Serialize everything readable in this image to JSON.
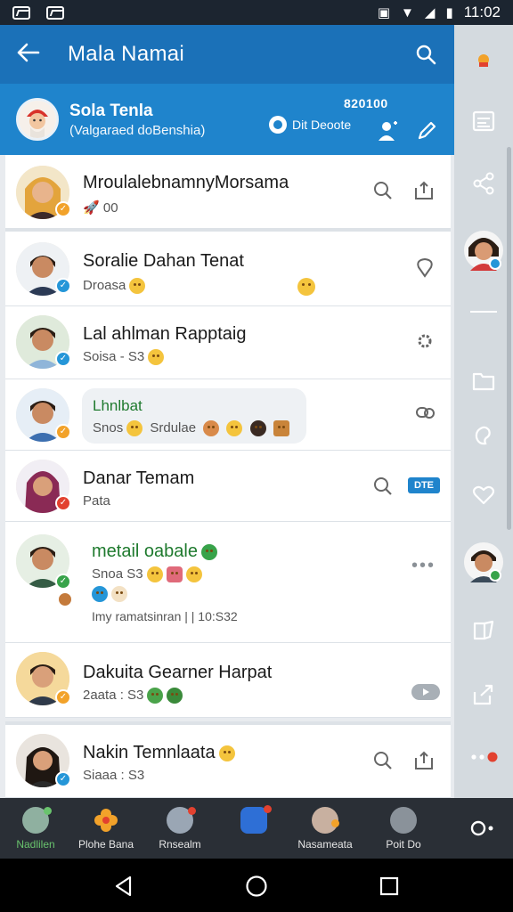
{
  "status_bar": {
    "time": "11:02"
  },
  "app_bar": {
    "title": "Mala Namai",
    "back_icon": "arrow-left-icon",
    "search_icon": "search-icon"
  },
  "profile": {
    "name": "Sola Tenla",
    "subtitle": "(Valgaraed doBenshia)",
    "count": "820100",
    "status_label": "Dit Deoote"
  },
  "chats": [
    {
      "name": "MroulalebnamnyMorsama",
      "sub": "00",
      "badge": "orange"
    },
    {
      "name": "Soralie Dahan Tenat",
      "sub": "Droasa",
      "badge": "blue"
    },
    {
      "name": "Lal ahlman Rapptaig",
      "sub": "Soisa - S3",
      "badge": "blue"
    },
    {
      "name": "Lhnlbat",
      "sub": "Snos",
      "sub2": "Srdulae",
      "badge": "orange"
    },
    {
      "name": "Danar Temam",
      "sub": "Pata",
      "badge": "red",
      "pill": "DTE"
    },
    {
      "name": "metail oabale",
      "sub": "Snoa S3",
      "meta": "Imy ramatsinran | | 10:S32",
      "badge": "green",
      "badge2": "brown"
    },
    {
      "name": "Dakuita Gearner Harpat",
      "sub": "2aata : S3",
      "badge": "orange"
    },
    {
      "name": "Nakin Temnlaata",
      "sub": "Siaaa : S3",
      "badge": "blue"
    }
  ],
  "tabs": [
    {
      "label": "Nadlilen",
      "active": true
    },
    {
      "label": "Plohe Bana",
      "active": false
    },
    {
      "label": "Rnsealm",
      "active": false
    },
    {
      "label": "",
      "active": false
    },
    {
      "label": "Nasameata",
      "active": false
    },
    {
      "label": "Poit Do",
      "active": false
    }
  ],
  "colors": {
    "primary": "#1b71b8",
    "header": "#1f84cc",
    "accent_green": "#69c36d"
  }
}
